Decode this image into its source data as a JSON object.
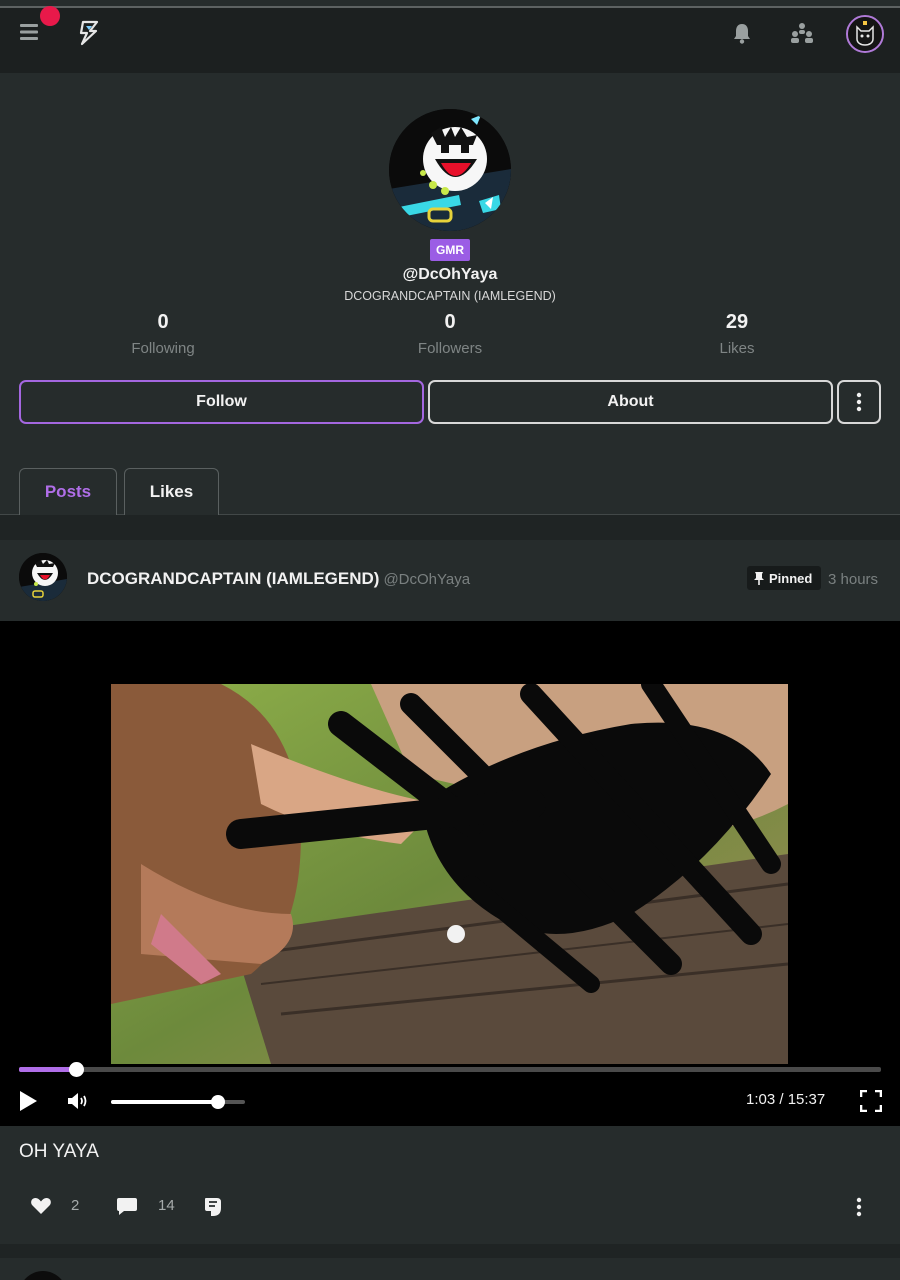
{
  "topbar": {
    "icons": [
      "menu-icon",
      "lightning-logo-icon",
      "bell-icon",
      "people-icon",
      "user-avatar-icon"
    ],
    "notification_dot_color": "#e8194a"
  },
  "profile": {
    "badge": "GMR",
    "handle": "@DcOhYaya",
    "display_name": "DCOGRANDCAPTAIN (IAMLEGEND)",
    "stats": {
      "following_count": "0",
      "following_label": "Following",
      "followers_count": "0",
      "followers_label": "Followers",
      "likes_count": "29",
      "likes_label": "Likes"
    },
    "buttons": {
      "follow": "Follow",
      "about": "About"
    },
    "accent_color": "#a467e0"
  },
  "tabs": [
    {
      "label": "Posts",
      "active": true
    },
    {
      "label": "Likes",
      "active": false
    }
  ],
  "post": {
    "author": "DCOGRANDCAPTAIN (IAMLEGEND)",
    "handle": "@DcOhYaya",
    "pinned_label": "Pinned",
    "time": "3 hours",
    "video": {
      "progress": 0.066,
      "volume": 0.8,
      "time": "1:03 / 15:37"
    },
    "caption": "OH YAYA",
    "likes": "2",
    "comments": "14"
  }
}
